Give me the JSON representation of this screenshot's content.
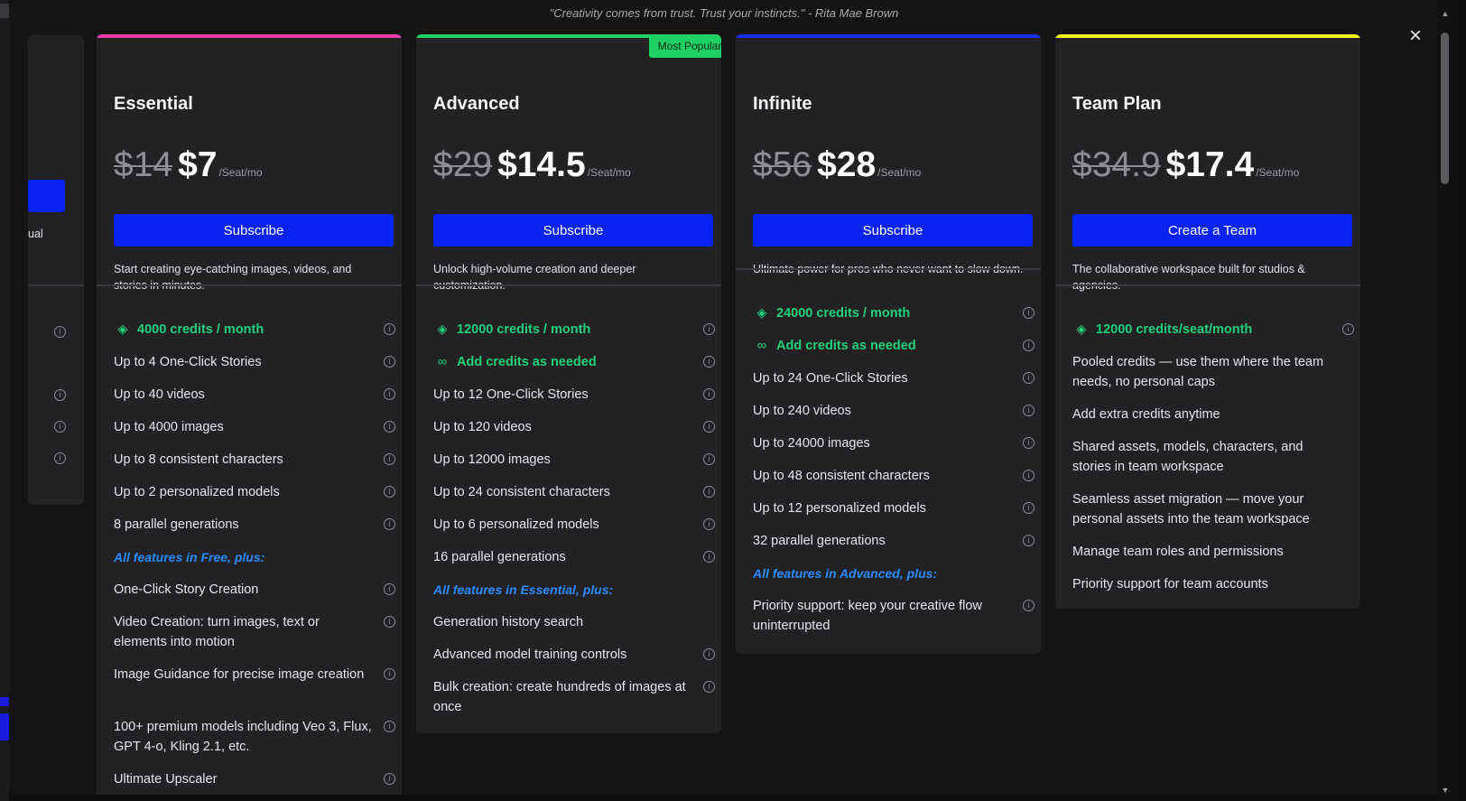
{
  "quote": "\"Creativity comes from trust. Trust your instincts.\" - Rita Mae Brown",
  "close_icon": "×",
  "free_fragment": "ual",
  "plans": [
    {
      "name": "Essential",
      "old_price": "$14",
      "new_price": "$7",
      "per": "/Seat/mo",
      "button": "Subscribe",
      "description": "Start creating eye-catching images, videos, and stories in minutes.",
      "accent": "#e93ba9",
      "features": [
        {
          "text": "4000 credits / month",
          "kind": "credit",
          "icon": "diamond-icon"
        },
        {
          "text": "Up to 4 One-Click Stories"
        },
        {
          "text": "Up to 40 videos"
        },
        {
          "text": "Up to 4000 images"
        },
        {
          "text": "Up to 8 consistent characters"
        },
        {
          "text": "Up to 2 personalized models"
        },
        {
          "text": "8 parallel generations"
        }
      ],
      "plus_heading": "All features in Free, plus:",
      "extras": [
        {
          "text": "One-Click Story Creation"
        },
        {
          "text": "Video Creation: turn images, text or elements into motion"
        },
        {
          "text": "Image Guidance for precise image creation"
        },
        {
          "text": "100+ premium models including Veo 3, Flux, GPT 4-o, Kling 2.1, etc."
        },
        {
          "text": "Ultimate Upscaler"
        }
      ]
    },
    {
      "name": "Advanced",
      "badge": "Most Popular",
      "old_price": "$29",
      "new_price": "$14.5",
      "per": "/Seat/mo",
      "button": "Subscribe",
      "description": "Unlock high-volume creation and deeper customization.",
      "accent": "#1fd065",
      "features": [
        {
          "text": "12000 credits / month",
          "kind": "credit",
          "icon": "diamond-icon"
        },
        {
          "text": "Add credits as needed",
          "kind": "credit",
          "icon": "infinity-icon"
        },
        {
          "text": "Up to 12 One-Click Stories"
        },
        {
          "text": "Up to 120 videos"
        },
        {
          "text": "Up to 12000 images"
        },
        {
          "text": "Up to 24 consistent characters"
        },
        {
          "text": "Up to 6 personalized models"
        },
        {
          "text": "16 parallel generations"
        }
      ],
      "plus_heading": "All features in Essential, plus:",
      "extras": [
        {
          "text": "Generation history search",
          "noinfo": true
        },
        {
          "text": "Advanced model training controls"
        },
        {
          "text": "Bulk creation: create hundreds of images at once"
        }
      ]
    },
    {
      "name": "Infinite",
      "old_price": "$56",
      "new_price": "$28",
      "per": "/Seat/mo",
      "button": "Subscribe",
      "description": "Ultimate power for pros who never want to slow down.",
      "accent": "#1530e8",
      "features": [
        {
          "text": "24000 credits / month",
          "kind": "credit",
          "icon": "diamond-icon"
        },
        {
          "text": "Add credits as needed",
          "kind": "credit",
          "icon": "infinity-icon"
        },
        {
          "text": "Up to 24 One-Click Stories"
        },
        {
          "text": "Up to 240 videos"
        },
        {
          "text": "Up to 24000 images"
        },
        {
          "text": "Up to 48 consistent characters"
        },
        {
          "text": "Up to 12 personalized models"
        },
        {
          "text": "32 parallel generations"
        }
      ],
      "plus_heading": "All features in Advanced, plus:",
      "extras": [
        {
          "text": "Priority support: keep your creative flow uninterrupted"
        }
      ]
    },
    {
      "name": "Team Plan",
      "old_price": "$34.9",
      "new_price": "$17.4",
      "per": "/Seat/mo",
      "button": "Create a Team",
      "description": "The collaborative workspace built for studios & agencies.",
      "accent": "#f2f20f",
      "features": [
        {
          "text": "12000 credits/seat/month",
          "kind": "credit",
          "icon": "diamond-icon"
        },
        {
          "text": "Pooled credits — use them where the team needs, no personal caps",
          "noinfo": true
        },
        {
          "text": "Add extra credits anytime",
          "noinfo": true
        },
        {
          "text": "Shared assets, models, characters, and stories in team workspace",
          "noinfo": true
        },
        {
          "text": "Seamless asset migration — move your personal assets into the team workspace",
          "noinfo": true
        },
        {
          "text": "Manage team roles and permissions",
          "noinfo": true
        },
        {
          "text": "Priority support for team accounts",
          "noinfo": true
        }
      ],
      "plus_heading": "",
      "extras": []
    }
  ]
}
